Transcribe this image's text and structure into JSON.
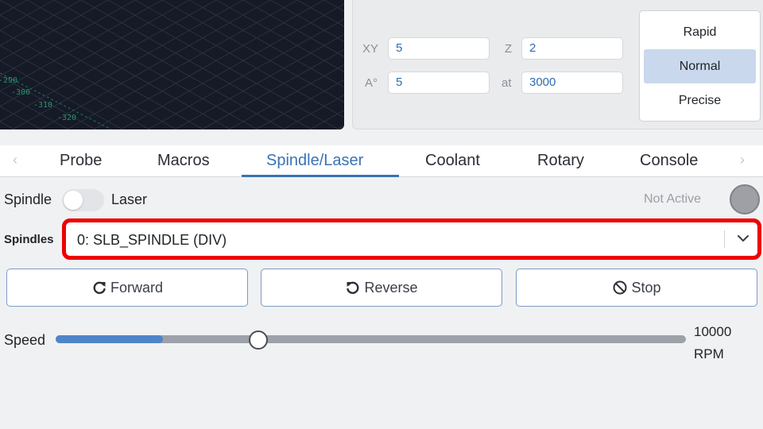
{
  "visualizer": {
    "axis_labels": [
      "-290",
      "-300",
      "-310",
      "-320"
    ]
  },
  "jog": {
    "xy_label": "XY",
    "xy_value": "5",
    "z_label": "Z",
    "z_value": "2",
    "a_label": "A°",
    "a_value": "5",
    "at_label": "at",
    "at_value": "3000",
    "speed_options": [
      "Rapid",
      "Normal",
      "Precise"
    ],
    "speed_selected": "Normal"
  },
  "tabs": {
    "items": [
      "Probe",
      "Macros",
      "Spindle/Laser",
      "Coolant",
      "Rotary",
      "Console"
    ],
    "active": "Spindle/Laser",
    "prev_icon": "chevron-left-icon",
    "next_icon": "chevron-right-icon"
  },
  "spindle": {
    "spindle_label": "Spindle",
    "laser_label": "Laser",
    "mode_laser": false,
    "status_text": "Not Active",
    "status_color": "#9ea0a6",
    "spindles_label": "Spindles",
    "selected_spindle": "0: SLB_SPINDLE (DIV)",
    "highlight_color": "#ee0000",
    "buttons": {
      "forward": "Forward",
      "reverse": "Reverse",
      "stop": "Stop"
    },
    "speed_label": "Speed",
    "speed_value_fraction": 0.16,
    "max_rpm": "10000",
    "rpm_unit": "RPM"
  },
  "colors": {
    "accent": "#3a72b5",
    "slider_fill": "#4e85c8"
  }
}
